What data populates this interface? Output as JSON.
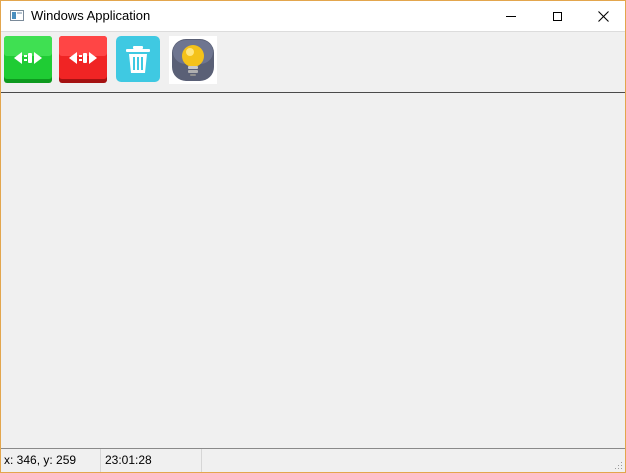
{
  "window": {
    "title": "Windows Application"
  },
  "titlebar": {
    "app_icon": "window-app-icon",
    "controls": [
      "minimize-icon",
      "maximize-icon",
      "close-icon"
    ]
  },
  "toolbar": {
    "buttons": [
      {
        "icon": "connect-icon",
        "color": "#1fcc34"
      },
      {
        "icon": "disconnect-icon",
        "color": "#f02424"
      },
      {
        "icon": "trash-icon",
        "color": "#3fc9e2"
      },
      {
        "icon": "lightbulb-icon",
        "color": "#f4c21a"
      }
    ]
  },
  "statusbar": {
    "coords": "x: 346, y: 259",
    "time": "23:01:28"
  }
}
